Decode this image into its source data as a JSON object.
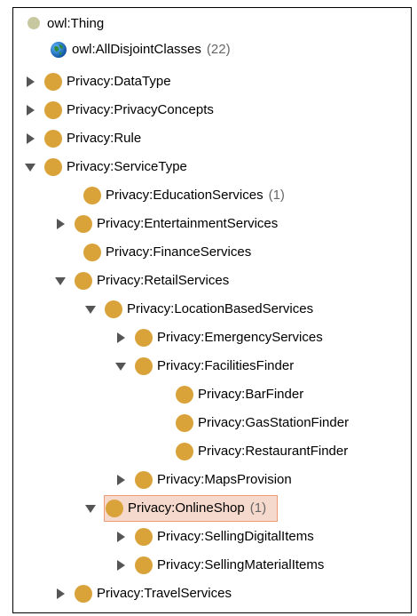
{
  "tree": {
    "root": {
      "label": "owl:Thing",
      "icon": "class-icon",
      "color": "#c8c8a0"
    },
    "items": [
      {
        "label": "owl:AllDisjointClasses",
        "count": "(22)",
        "icon": "globe-icon",
        "expandable": false
      },
      {
        "label": "Privacy:DataType",
        "count": "",
        "icon": "class-icon",
        "expandable": true,
        "expanded": false
      },
      {
        "label": "Privacy:PrivacyConcepts",
        "count": "",
        "icon": "class-icon",
        "expandable": true,
        "expanded": false
      },
      {
        "label": "Privacy:Rule",
        "count": "",
        "icon": "class-icon",
        "expandable": true,
        "expanded": false
      },
      {
        "label": "Privacy:ServiceType",
        "count": "",
        "icon": "class-icon",
        "expandable": true,
        "expanded": true
      },
      {
        "label": "Privacy:EducationServices",
        "count": "(1)",
        "icon": "class-icon",
        "expandable": false
      },
      {
        "label": "Privacy:EntertainmentServices",
        "count": "",
        "icon": "class-icon",
        "expandable": true,
        "expanded": false
      },
      {
        "label": "Privacy:FinanceServices",
        "count": "",
        "icon": "class-icon",
        "expandable": false
      },
      {
        "label": "Privacy:RetailServices",
        "count": "",
        "icon": "class-icon",
        "expandable": true,
        "expanded": true
      },
      {
        "label": "Privacy:LocationBasedServices",
        "count": "",
        "icon": "class-icon",
        "expandable": true,
        "expanded": true
      },
      {
        "label": "Privacy:EmergencyServices",
        "count": "",
        "icon": "class-icon",
        "expandable": true,
        "expanded": false
      },
      {
        "label": "Privacy:FacilitiesFinder",
        "count": "",
        "icon": "class-icon",
        "expandable": true,
        "expanded": true
      },
      {
        "label": "Privacy:BarFinder",
        "count": "",
        "icon": "class-icon",
        "expandable": false
      },
      {
        "label": "Privacy:GasStationFinder",
        "count": "",
        "icon": "class-icon",
        "expandable": false
      },
      {
        "label": "Privacy:RestaurantFinder",
        "count": "",
        "icon": "class-icon",
        "expandable": false
      },
      {
        "label": "Privacy:MapsProvision",
        "count": "",
        "icon": "class-icon",
        "expandable": true,
        "expanded": false
      },
      {
        "label": "Privacy:OnlineShop",
        "count": "(1)",
        "icon": "class-icon",
        "expandable": true,
        "expanded": true,
        "selected": true
      },
      {
        "label": "Privacy:SellingDigitalItems",
        "count": "",
        "icon": "class-icon",
        "expandable": true,
        "expanded": false
      },
      {
        "label": "Privacy:SellingMaterialItems",
        "count": "",
        "icon": "class-icon",
        "expandable": true,
        "expanded": false
      },
      {
        "label": "Privacy:TravelServices",
        "count": "",
        "icon": "class-icon",
        "expandable": true,
        "expanded": false
      }
    ]
  },
  "colors": {
    "class_icon": "#d9a33a",
    "root_icon": "#c8c8a0",
    "selection_fill": "#f5d9cc",
    "selection_border": "#ef9a78",
    "triangle": "#555555",
    "count_text": "#666666"
  }
}
